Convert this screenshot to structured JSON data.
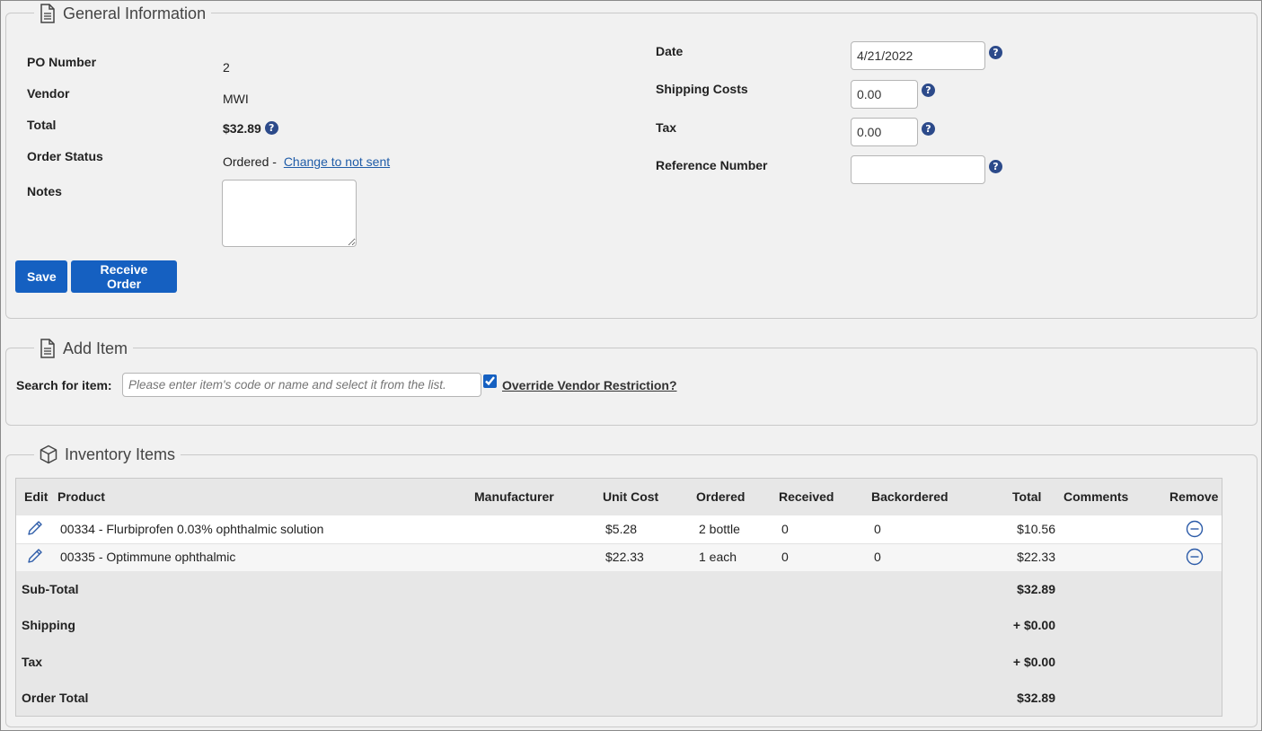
{
  "general": {
    "legend": "General Information",
    "po_number_label": "PO Number",
    "po_number": "2",
    "vendor_label": "Vendor",
    "vendor": "MWI",
    "total_label": "Total",
    "total": "$32.89",
    "order_status_label": "Order Status",
    "order_status": "Ordered -",
    "change_status_link": "Change to not sent",
    "notes_label": "Notes",
    "notes_value": "",
    "date_label": "Date",
    "date_value": "4/21/2022",
    "shipping_label": "Shipping Costs",
    "shipping_value": "0.00",
    "tax_label": "Tax",
    "tax_value": "0.00",
    "reference_label": "Reference Number",
    "reference_value": "",
    "save_button": "Save",
    "receive_button": "Receive Order",
    "help_glyph": "?"
  },
  "add_item": {
    "legend": "Add Item",
    "search_label": "Search for item:",
    "search_placeholder": "Please enter item's code or name and select it from the list.",
    "override_checked": true,
    "override_label": "Override Vendor Restriction?"
  },
  "inventory": {
    "legend": "Inventory Items",
    "columns": [
      "Edit",
      "Product",
      "Manufacturer",
      "Unit Cost",
      "Ordered",
      "Received",
      "Backordered",
      "Total",
      "Comments",
      "Remove"
    ],
    "rows": [
      {
        "product": "00334 - Flurbiprofen 0.03% ophthalmic solution",
        "manufacturer": "",
        "unit_cost": "$5.28",
        "ordered": "2 bottle",
        "received": "0",
        "backordered": "0",
        "total": "$10.56",
        "comments": ""
      },
      {
        "product": "00335 - Optimmune ophthalmic",
        "manufacturer": "",
        "unit_cost": "$22.33",
        "ordered": "1 each",
        "received": "0",
        "backordered": "0",
        "total": "$22.33",
        "comments": ""
      }
    ],
    "summary": [
      {
        "label": "Sub-Total",
        "value": "$32.89"
      },
      {
        "label": "Shipping",
        "value": "+ $0.00"
      },
      {
        "label": "Tax",
        "value": "+ $0.00"
      },
      {
        "label": "Order Total",
        "value": "$32.89"
      }
    ]
  },
  "icons": {
    "legend_general": "document-icon",
    "legend_add_item": "document-icon",
    "legend_inventory": "box-icon",
    "edit": "pencil-icon",
    "remove": "minus-circle-icon",
    "help": "question-circle-icon"
  },
  "colors": {
    "primary_button": "#1560c1",
    "help_icon": "#2c4a8a",
    "link": "#1f5ca8",
    "background": "#f1f1f1"
  }
}
